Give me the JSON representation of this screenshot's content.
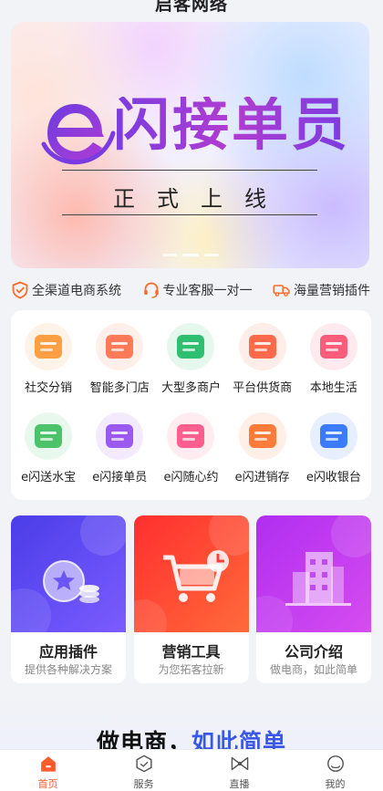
{
  "header": {
    "title": "启客网络"
  },
  "banner": {
    "title": "闪接单员",
    "subtitle": "正式上线",
    "slides": 3,
    "active_slide": 1
  },
  "features": [
    {
      "icon": "shield-check-icon",
      "label": "全渠道电商系统"
    },
    {
      "icon": "headset-icon",
      "label": "专业客服一对一"
    },
    {
      "icon": "delivery-truck-icon",
      "label": "海量营销插件"
    }
  ],
  "grid": [
    {
      "icon": "social-distribution-icon",
      "label": "社交分销",
      "color": "#ff9f43"
    },
    {
      "icon": "multi-store-icon",
      "label": "智能多门店",
      "color": "#ff7a59"
    },
    {
      "icon": "multi-merchant-icon",
      "label": "大型多商户",
      "color": "#2fbf71"
    },
    {
      "icon": "supply-platform-icon",
      "label": "平台供货商",
      "color": "#ff6b4a"
    },
    {
      "icon": "local-life-icon",
      "label": "本地生活",
      "color": "#ff5b7a"
    },
    {
      "icon": "water-delivery-icon",
      "label": "e闪送水宝",
      "color": "#4cc36b"
    },
    {
      "icon": "courier-icon",
      "label": "e闪接单员",
      "color": "#9b59f0"
    },
    {
      "icon": "appointment-icon",
      "label": "e闪随心约",
      "color": "#ff5f8f"
    },
    {
      "icon": "inventory-icon",
      "label": "e闪进销存",
      "color": "#ff7b3a"
    },
    {
      "icon": "cashier-icon",
      "label": "e闪收银台",
      "color": "#3b7bff"
    }
  ],
  "tiles": [
    {
      "title": "应用插件",
      "subtitle": "提供各种解决方案",
      "icon": "coin-plugin-icon",
      "color": "#5b4ff0"
    },
    {
      "title": "营销工具",
      "subtitle": "为您拓客拉新",
      "icon": "shopping-cart-icon",
      "color": "#ff3b3b"
    },
    {
      "title": "公司介绍",
      "subtitle": "做电商，如此简单",
      "icon": "office-building-icon",
      "color": "#c43cf0"
    }
  ],
  "slogan": {
    "main": "做电商，",
    "accent": "如此简单"
  },
  "tabbar": [
    {
      "label": "首页",
      "icon": "home-icon",
      "active": true
    },
    {
      "label": "服务",
      "icon": "service-icon",
      "active": false
    },
    {
      "label": "直播",
      "icon": "live-bowtie-icon",
      "active": false
    },
    {
      "label": "我的",
      "icon": "profile-icon",
      "active": false
    }
  ],
  "colors": {
    "accent": "#ff5a2a",
    "slogan_accent": "#3a57e8"
  }
}
